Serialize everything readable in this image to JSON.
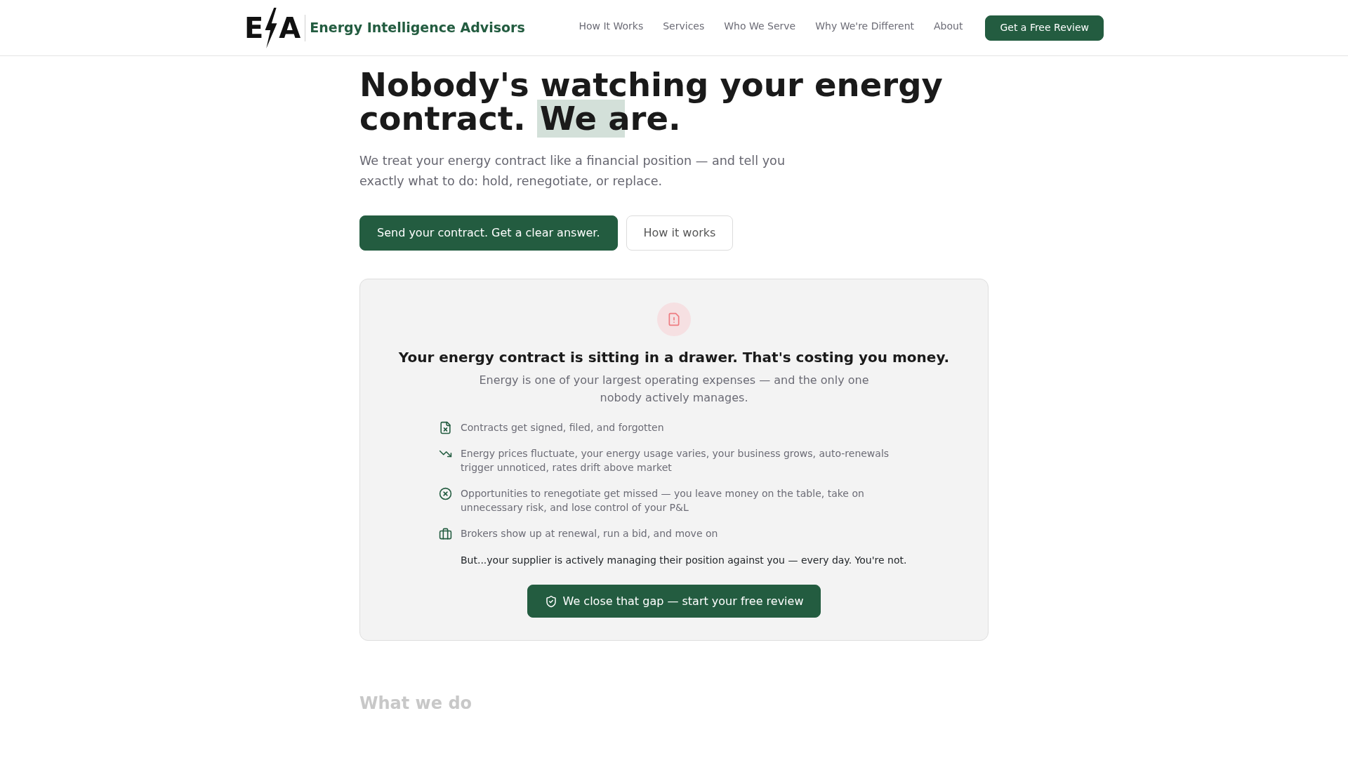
{
  "navbar": {
    "logo_letters": [
      "E",
      "A"
    ],
    "brand": "Energy Intelligence Advisors",
    "links": [
      "How It Works",
      "Services",
      "Who We Serve",
      "Why We're Different",
      "About"
    ],
    "cta": "Get a Free Review"
  },
  "hero": {
    "heading": "Nobody's watching your energy contract.",
    "heading_highlight": "We are.",
    "lead": "We treat your energy contract like a financial position — and tell you exactly what to do: hold, renegotiate, or replace.",
    "buttons": [
      {
        "label": "Send your contract. Get a clear answer.",
        "kind": "primary"
      },
      {
        "label": "How it works",
        "kind": "secondary"
      }
    ]
  },
  "problem_card": {
    "title": "Your energy contract is sitting in a drawer. That's costing you money.",
    "subtitle": "Energy is one of your largest operating expenses — and the only one nobody actively manages.",
    "points": [
      "Contracts get signed, filed, and forgotten",
      "Energy prices fluctuate, your energy usage varies, your business grows, auto-renewals trigger unnoticed, rates drift above market",
      "Opportunities to renegotiate get missed — you leave money on the table, take on unnecessary risk, and lose control of your P&L",
      "Brokers show up at renewal, run a bid, and move on"
    ],
    "closing": "But...your supplier is actively managing their position against you — every day. You're not.",
    "cta": "We close that gap — start your free review"
  },
  "next_section": {
    "title": "What we do"
  }
}
